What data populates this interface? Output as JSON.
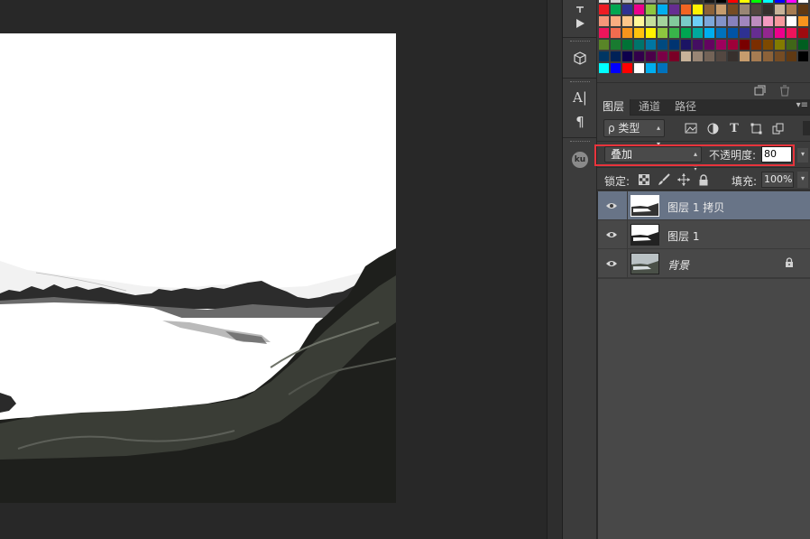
{
  "layers_panel": {
    "tabs": [
      {
        "label": "图层",
        "active": true
      },
      {
        "label": "通道",
        "active": false
      },
      {
        "label": "路径",
        "active": false
      }
    ],
    "menu_icon": "panel-menu-icon",
    "filter": {
      "label": "ρ 类型"
    },
    "blend_mode": {
      "value": "叠加"
    },
    "opacity": {
      "label": "不透明度:",
      "value": "80"
    },
    "lock": {
      "label": "锁定:"
    },
    "fill": {
      "label": "填充:",
      "value": "100%"
    },
    "layers": [
      {
        "name": "图层 1 拷贝",
        "selected": true,
        "locked": false
      },
      {
        "name": "图层 1",
        "selected": false,
        "locked": false
      },
      {
        "name": "背景",
        "selected": false,
        "locked": true
      }
    ]
  },
  "toolstrip": {
    "ku_label": "ku",
    "type_label": "A|",
    "para_label": "¶"
  },
  "colors": {
    "highlight": "#e8343c",
    "selected_layer": "#687487",
    "panel_bg": "#3c3c3c",
    "canvas_bg": "#282828"
  }
}
